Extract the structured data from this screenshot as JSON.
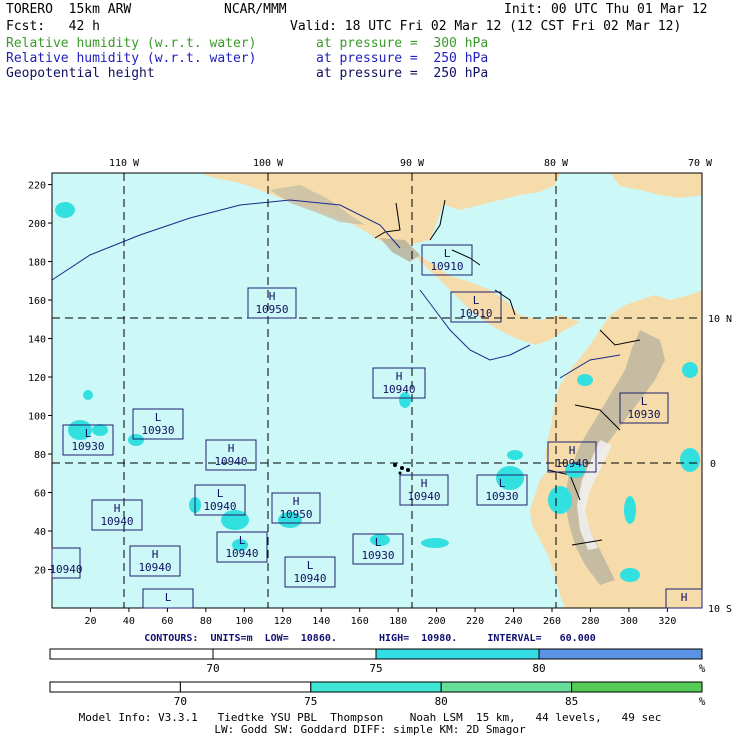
{
  "header": {
    "model": "TORERO  15km ARW",
    "org": "NCAR/MMM",
    "init": "Init: 00 UTC Thu 01 Mar 12",
    "fcst": "Fcst:   42 h",
    "valid": "Valid: 18 UTC Fri 02 Mar 12 (12 CST Fri 02 Mar 12)",
    "fields": [
      {
        "name": "Relative humidity (w.r.t. water)",
        "level": "at pressure =  300 hPa",
        "color": "#3a9a2a"
      },
      {
        "name": "Relative humidity (w.r.t. water)",
        "level": "at pressure =  250 hPa",
        "color": "#2020c0"
      },
      {
        "name": "Geopotential height",
        "level": "at pressure =  250 hPa",
        "color": "#101060"
      }
    ]
  },
  "map": {
    "top_lon_labels": [
      "110 W",
      "100 W",
      "90 W",
      "80 W",
      "70 W"
    ],
    "right_lat_labels": [
      "10 N",
      "0",
      "10 S"
    ],
    "left_ticks": [
      "220",
      "200",
      "180",
      "160",
      "140",
      "120",
      "100",
      "80",
      "60",
      "40",
      "20"
    ],
    "bottom_ticks": [
      "20",
      "40",
      "60",
      "80",
      "100",
      "120",
      "140",
      "160",
      "180",
      "200",
      "220",
      "240",
      "260",
      "280",
      "300",
      "320"
    ],
    "colors": {
      "ocean": "#ccf8f8",
      "land": "#f5dcaa",
      "rh_cyan": "#33e0e0",
      "rh_green": "#8ae8a0",
      "box_stroke": "#202070",
      "grid": "#000000"
    },
    "hl_labels": [
      {
        "letter": "L",
        "value": "10910"
      },
      {
        "letter": "H",
        "value": "10950"
      },
      {
        "letter": "L",
        "value": "10910"
      },
      {
        "letter": "H",
        "value": "10940"
      },
      {
        "letter": "L",
        "value": "10930"
      },
      {
        "letter": "L",
        "value": "10930"
      },
      {
        "letter": "L",
        "value": "10930"
      },
      {
        "letter": "H",
        "value": "10940"
      },
      {
        "letter": "H",
        "value": "10940"
      },
      {
        "letter": "H",
        "value": "10940"
      },
      {
        "letter": "L",
        "value": "10930"
      },
      {
        "letter": "L",
        "value": "10940"
      },
      {
        "letter": "H",
        "value": "10950"
      },
      {
        "letter": "H",
        "value": "10940"
      },
      {
        "letter": "L",
        "value": "10940"
      },
      {
        "letter": "",
        "value": "10940"
      },
      {
        "letter": "L",
        "value": "10930"
      },
      {
        "letter": "H",
        "value": "10940"
      },
      {
        "letter": "L",
        "value": "10940"
      },
      {
        "letter": "L",
        "value": ""
      },
      {
        "letter": "H",
        "value": ""
      }
    ]
  },
  "contour_info": "CONTOURS:  UNITS=m  LOW=  10860.       HIGH=  10980.     INTERVAL=   60.000",
  "colorbar1": {
    "ticks": [
      "70",
      "75",
      "80"
    ],
    "unit": "%",
    "segments": [
      "#ffffff",
      "#ffffff",
      "#33dde6",
      "#5b93e6"
    ]
  },
  "colorbar2": {
    "ticks": [
      "70",
      "75",
      "80",
      "85"
    ],
    "unit": "%",
    "segments": [
      "#ffffff",
      "#ffffff",
      "#3ee6d6",
      "#66dd99",
      "#55cc55"
    ]
  },
  "footer": {
    "line1": "Model Info: V3.3.1   Tiedtke YSU PBL  Thompson    Noah LSM  15 km,   44 levels,   49 sec",
    "line2": "LW: Godd SW: Goddard DIFF: simple KM: 2D Smagor"
  }
}
